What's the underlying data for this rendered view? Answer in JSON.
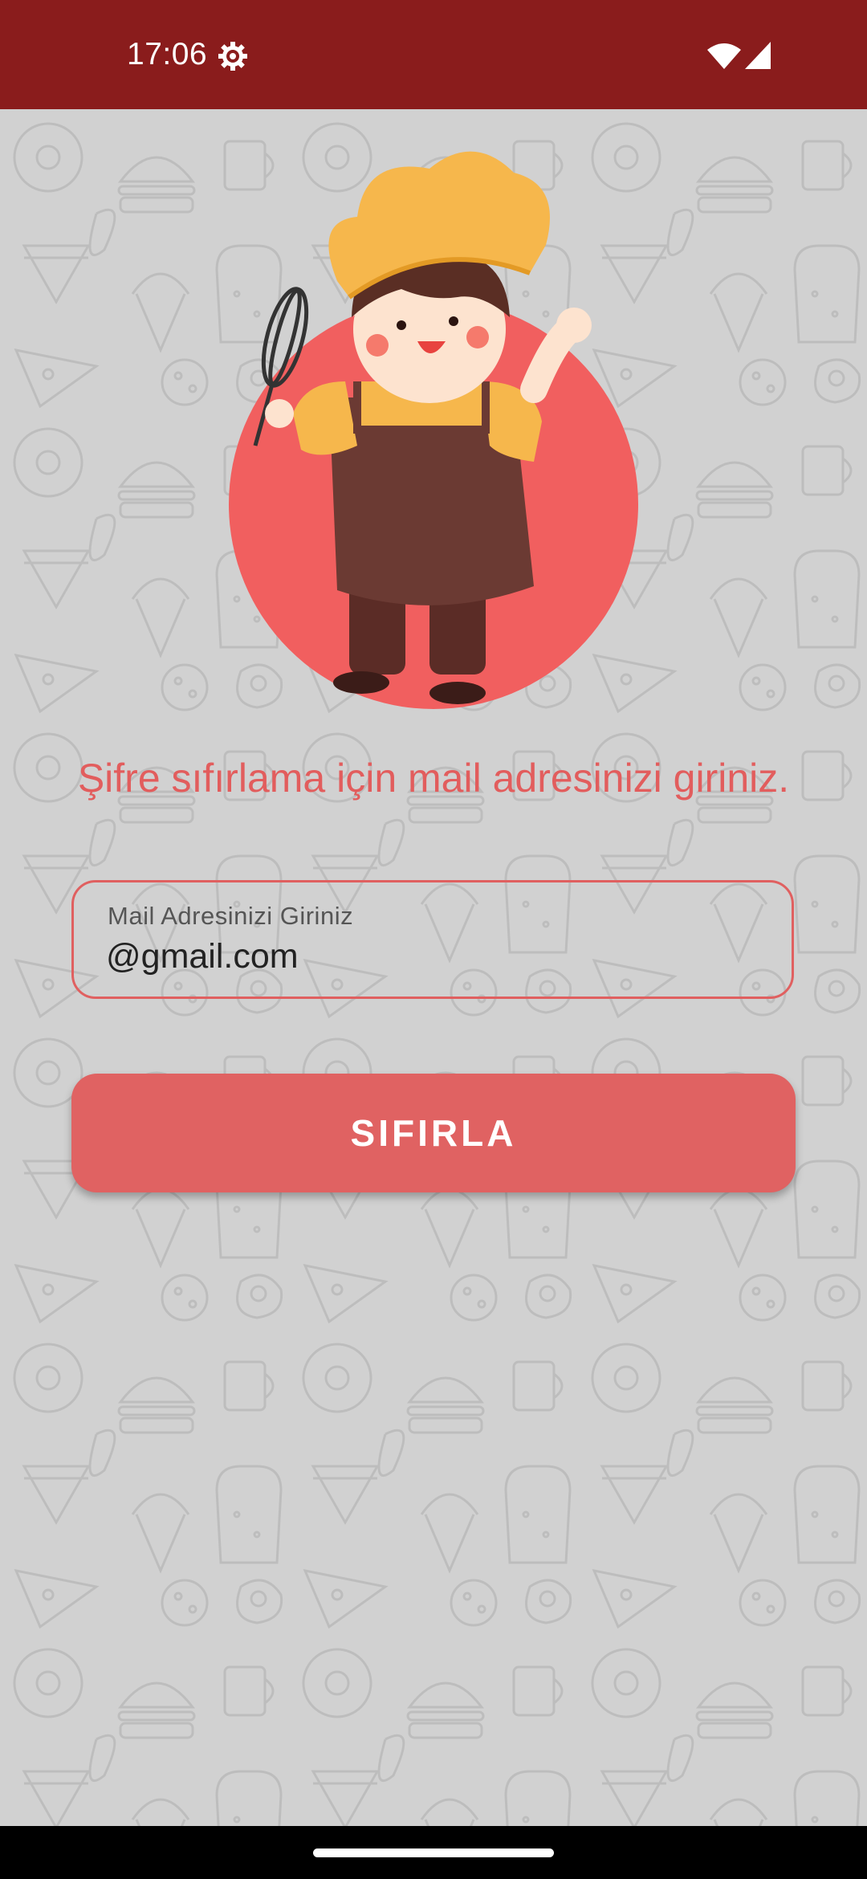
{
  "status_bar": {
    "time": "17:06",
    "icons": [
      "gear-icon",
      "wifi-icon",
      "signal-icon"
    ],
    "background_color": "#8a1c1c"
  },
  "illustration": {
    "icon": "chef-illustration",
    "circle_color": "#f15f5f",
    "hat_color": "#f6b74c",
    "apron_color": "#6b3a33"
  },
  "prompt": {
    "text": "Şifre sıfırlama için mail adresinizi giriniz."
  },
  "email_field": {
    "label": "Mail Adresinizi Giriniz",
    "value": "@gmail.com"
  },
  "reset_button": {
    "label": "SIFIRLA"
  },
  "colors": {
    "accent": "#e06262",
    "background": "#d1d1d1"
  }
}
